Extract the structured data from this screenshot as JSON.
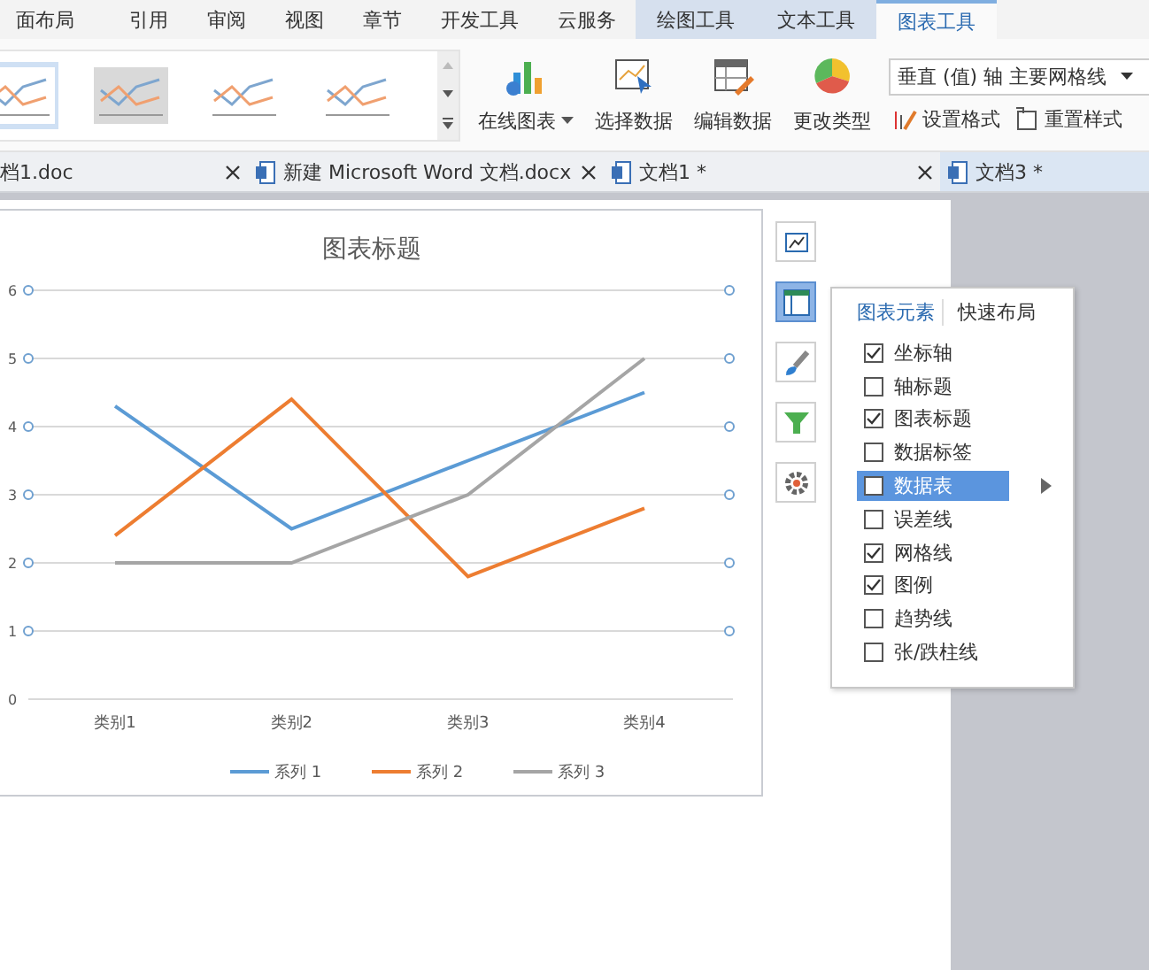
{
  "ribbon_tabs": [
    {
      "label": "面布局",
      "selected": false,
      "kind": "normal"
    },
    {
      "label": "引用",
      "selected": false,
      "kind": "normal"
    },
    {
      "label": "审阅",
      "selected": false,
      "kind": "normal"
    },
    {
      "label": "视图",
      "selected": false,
      "kind": "normal"
    },
    {
      "label": "章节",
      "selected": false,
      "kind": "normal"
    },
    {
      "label": "开发工具",
      "selected": false,
      "kind": "normal"
    },
    {
      "label": "云服务",
      "selected": false,
      "kind": "normal"
    },
    {
      "label": "绘图工具",
      "selected": false,
      "kind": "context"
    },
    {
      "label": "文本工具",
      "selected": false,
      "kind": "context"
    },
    {
      "label": "图表工具",
      "selected": true,
      "kind": "context"
    }
  ],
  "style_gallery": [
    {
      "selected": true
    },
    {
      "selected": false
    },
    {
      "selected": false
    },
    {
      "selected": false
    }
  ],
  "ribbon_buttons": [
    {
      "label": "在线图表",
      "kind": "bars",
      "dropdown": true
    },
    {
      "label": "选择数据",
      "kind": "picker",
      "dropdown": false
    },
    {
      "label": "编辑数据",
      "kind": "table",
      "dropdown": false
    },
    {
      "label": "更改类型",
      "kind": "pie",
      "dropdown": false
    }
  ],
  "element_dropdown": {
    "value": "垂直 (值) 轴 主要网格线"
  },
  "format_buttons": [
    {
      "label": "设置格式",
      "kind": "brush"
    },
    {
      "label": "重置样式",
      "kind": "reset"
    }
  ],
  "doc_tabs": [
    {
      "label": "档1.doc",
      "selected": false,
      "kind": "doc"
    },
    {
      "label": "新建 Microsoft Word 文档.docx",
      "selected": false,
      "kind": "docx"
    },
    {
      "label": "文档1 *",
      "selected": false,
      "kind": "docx"
    },
    {
      "label": "文档3 *",
      "selected": true,
      "kind": "docx"
    }
  ],
  "chart": {
    "chart_data": {
      "type": "line",
      "title": "图表标题",
      "categories": [
        "类别1",
        "类别2",
        "类别3",
        "类别4"
      ],
      "ylim": [
        0,
        6
      ],
      "grid": true,
      "legend": true,
      "yticks": [
        0,
        1,
        2,
        3,
        4,
        5,
        6
      ],
      "series": [
        {
          "name": "系列 1",
          "color": "#5b9bd5",
          "values": [
            4.3,
            2.5,
            3.5,
            4.5
          ]
        },
        {
          "name": "系列 2",
          "color": "#ed7d31",
          "values": [
            2.4,
            4.4,
            1.8,
            2.8
          ]
        },
        {
          "name": "系列 3",
          "color": "#a5a5a5",
          "values": [
            2,
            2,
            3,
            5
          ]
        }
      ]
    }
  },
  "side_tools": [
    {
      "kind": "area",
      "selected": false
    },
    {
      "kind": "layout",
      "selected": true
    },
    {
      "kind": "brush",
      "selected": false
    },
    {
      "kind": "filter",
      "selected": false
    },
    {
      "kind": "gear",
      "selected": false
    }
  ],
  "elements_panel": {
    "tabs": [
      {
        "label": "图表元素",
        "selected": true
      },
      {
        "label": "快速布局",
        "selected": false
      }
    ],
    "items": [
      {
        "label": "坐标轴",
        "checked": true,
        "selected": false,
        "submenu": false
      },
      {
        "label": "轴标题",
        "checked": false,
        "selected": false,
        "submenu": false
      },
      {
        "label": "图表标题",
        "checked": true,
        "selected": false,
        "submenu": false
      },
      {
        "label": "数据标签",
        "checked": false,
        "selected": false,
        "submenu": false
      },
      {
        "label": "数据表",
        "checked": false,
        "selected": true,
        "submenu": true
      },
      {
        "label": "误差线",
        "checked": false,
        "selected": false,
        "submenu": false
      },
      {
        "label": "网格线",
        "checked": true,
        "selected": false,
        "submenu": false
      },
      {
        "label": "图例",
        "checked": true,
        "selected": false,
        "submenu": false
      },
      {
        "label": "趋势线",
        "checked": false,
        "selected": false,
        "submenu": false
      },
      {
        "label": "张/跌柱线",
        "checked": false,
        "selected": false,
        "submenu": false
      }
    ]
  }
}
